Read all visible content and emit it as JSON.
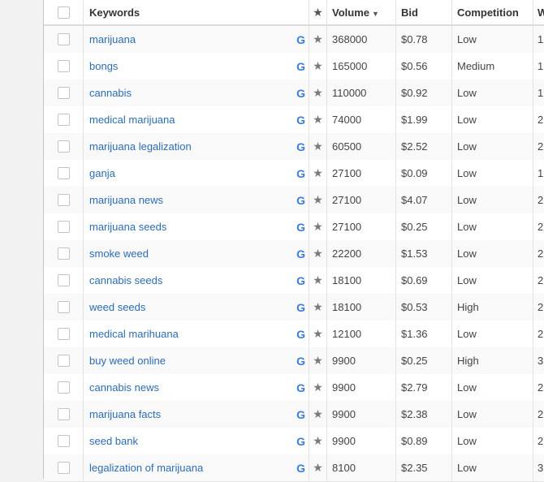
{
  "table": {
    "headers": {
      "keywords": "Keywords",
      "volume": "Volume",
      "bid": "Bid",
      "competition": "Competition",
      "more": "W"
    },
    "g_label": "G",
    "star": "★",
    "rows": [
      {
        "keyword": "marijuana",
        "volume": "368000",
        "bid": "$0.78",
        "competition": "Low",
        "more": "1"
      },
      {
        "keyword": "bongs",
        "volume": "165000",
        "bid": "$0.56",
        "competition": "Medium",
        "more": "1"
      },
      {
        "keyword": "cannabis",
        "volume": "110000",
        "bid": "$0.92",
        "competition": "Low",
        "more": "1"
      },
      {
        "keyword": "medical marijuana",
        "volume": "74000",
        "bid": "$1.99",
        "competition": "Low",
        "more": "2"
      },
      {
        "keyword": "marijuana legalization",
        "volume": "60500",
        "bid": "$2.52",
        "competition": "Low",
        "more": "2"
      },
      {
        "keyword": "ganja",
        "volume": "27100",
        "bid": "$0.09",
        "competition": "Low",
        "more": "1"
      },
      {
        "keyword": "marijuana news",
        "volume": "27100",
        "bid": "$4.07",
        "competition": "Low",
        "more": "2"
      },
      {
        "keyword": "marijuana seeds",
        "volume": "27100",
        "bid": "$0.25",
        "competition": "Low",
        "more": "2"
      },
      {
        "keyword": "smoke weed",
        "volume": "22200",
        "bid": "$1.53",
        "competition": "Low",
        "more": "2"
      },
      {
        "keyword": "cannabis seeds",
        "volume": "18100",
        "bid": "$0.69",
        "competition": "Low",
        "more": "2"
      },
      {
        "keyword": "weed seeds",
        "volume": "18100",
        "bid": "$0.53",
        "competition": "High",
        "more": "2"
      },
      {
        "keyword": "medical marihuana",
        "volume": "12100",
        "bid": "$1.36",
        "competition": "Low",
        "more": "2"
      },
      {
        "keyword": "buy weed online",
        "volume": "9900",
        "bid": "$0.25",
        "competition": "High",
        "more": "3"
      },
      {
        "keyword": "cannabis news",
        "volume": "9900",
        "bid": "$2.79",
        "competition": "Low",
        "more": "2"
      },
      {
        "keyword": "marijuana facts",
        "volume": "9900",
        "bid": "$2.38",
        "competition": "Low",
        "more": "2"
      },
      {
        "keyword": "seed bank",
        "volume": "9900",
        "bid": "$0.89",
        "competition": "Low",
        "more": "2"
      },
      {
        "keyword": "legalization of marijuana",
        "volume": "8100",
        "bid": "$2.35",
        "competition": "Low",
        "more": "3"
      }
    ]
  },
  "icons": {
    "sort": "sort-descending-icon",
    "google": "google-icon",
    "star": "star-icon"
  },
  "colors": {
    "link": "#2b6db5",
    "google": "#3b7dd8",
    "star": "#7a7a7a"
  }
}
